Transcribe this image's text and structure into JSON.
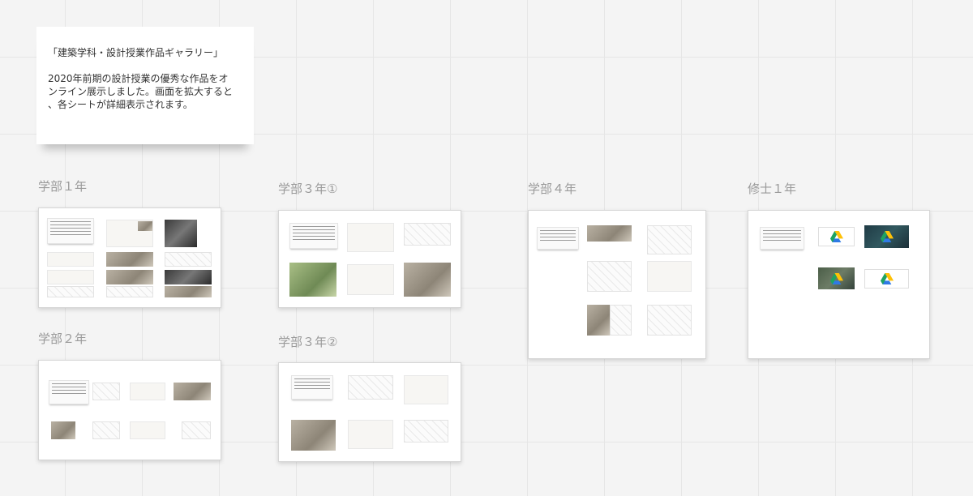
{
  "sticky_note": {
    "title": "「建築学科・設計授業作品ギャラリー」",
    "body_lines": [
      "2020年前期の設計授業の優秀な作品をオ",
      "ンライン展示しました。画面を拡大すると",
      "、各シートが詳細表示されます。"
    ]
  },
  "sections": [
    {
      "id": "year1",
      "label": "学部１年"
    },
    {
      "id": "year2",
      "label": "学部２年"
    },
    {
      "id": "year3a",
      "label": "学部３年①"
    },
    {
      "id": "year3b",
      "label": "学部３年②"
    },
    {
      "id": "year4",
      "label": "学部４年"
    },
    {
      "id": "master1",
      "label": "修士１年"
    }
  ],
  "icons": {
    "drive": "google-drive-icon"
  },
  "colors": {
    "drive_green": "#1ea362",
    "drive_yellow": "#ffc107",
    "drive_blue": "#2f7ae5",
    "label_gray": "#9a9a9a",
    "grid_line": "#e6e6e6"
  }
}
